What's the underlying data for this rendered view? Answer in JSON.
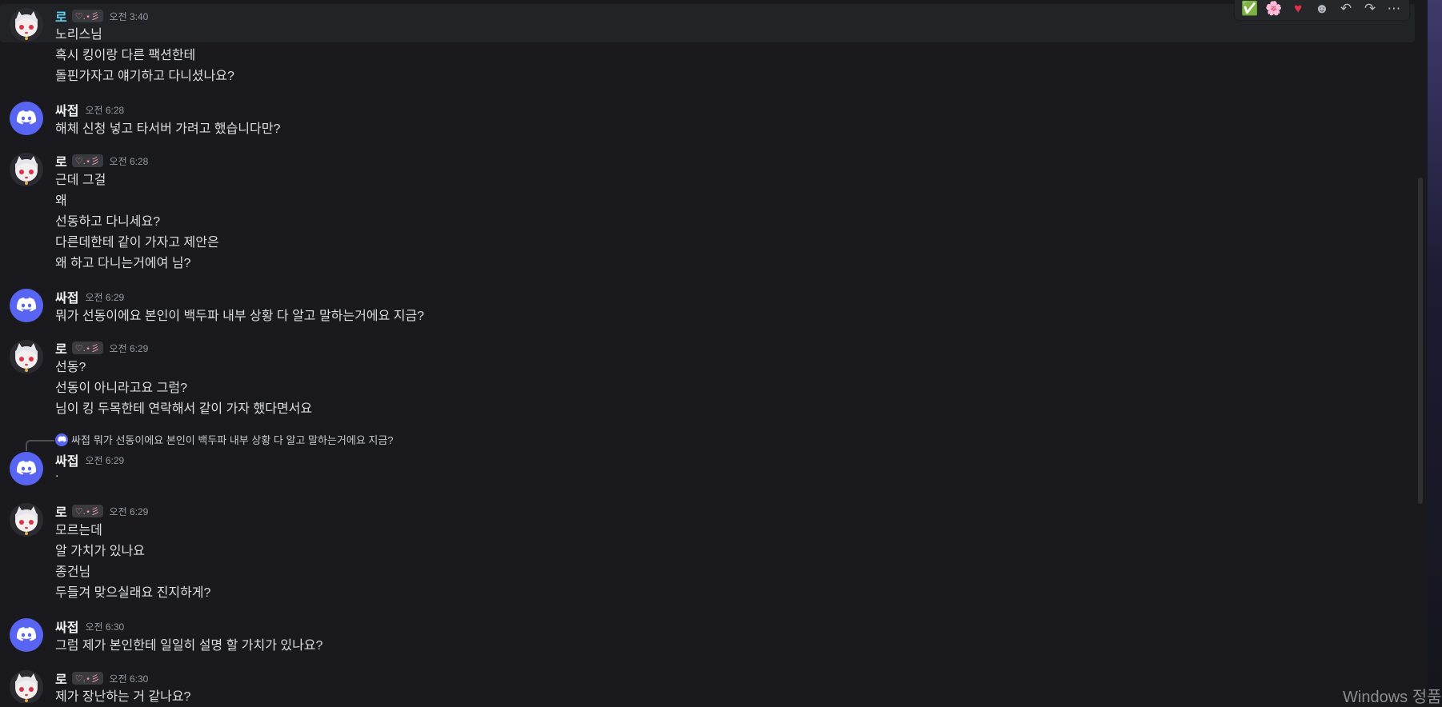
{
  "toolbar": {
    "icons": [
      "check-reaction",
      "cherry-blossom-reaction",
      "heart-reaction",
      "add-reaction-icon",
      "reply-icon",
      "forward-icon",
      "more-icon"
    ],
    "check": "✅",
    "flower": "🌸",
    "heart": "♥",
    "smile": "☻",
    "reply": "↶",
    "forward": "↷",
    "more": "⋯"
  },
  "users": {
    "ro": {
      "name": "로",
      "tag": "♡.⋆彡"
    },
    "ssajeop": {
      "name": "싸접"
    }
  },
  "messages": [
    {
      "author": "로",
      "time": "오전 3:40",
      "lines": [
        "노리스님",
        "혹시 킹이랑 다른 팩션한테",
        "돌핀가자고 얘기하고 다니셨나요?"
      ]
    },
    {
      "author": "싸접",
      "time": "오전 6:28",
      "lines": [
        "해체 신청 넣고 타서버 가려고 했습니다만?"
      ]
    },
    {
      "author": "로",
      "time": "오전 6:28",
      "lines": [
        "근데 그걸",
        "왜",
        "선동하고 다니세요?",
        "다른데한테 같이 가자고 제안은",
        "왜 하고 다니는거에여 님?"
      ]
    },
    {
      "author": "싸접",
      "time": "오전 6:29",
      "lines": [
        "뭐가 선동이에요 본인이 백두파 내부 상황 다 알고 말하는거에요 지금?"
      ]
    },
    {
      "author": "로",
      "time": "오전 6:29",
      "lines": [
        "선동?",
        "선동이 아니라고요 그럼?",
        "님이 킹 두목한테 연락해서 같이 가자 했다면서요"
      ]
    },
    {
      "author": "싸접",
      "time": "오전 6:29",
      "reply_name": "싸접",
      "reply_text": "뭐가 선동이에요 본인이 백두파 내부 상황 다 알고 말하는거에요 지금?",
      "lines": [
        "."
      ]
    },
    {
      "author": "로",
      "time": "오전 6:29",
      "lines": [
        "모르는데",
        "알 가치가 있나요",
        "종건님",
        "두들겨 맞으실래요 진지하게?"
      ]
    },
    {
      "author": "싸접",
      "time": "오전 6:30",
      "lines": [
        "그럼 제가 본인한테 일일히 설명 할 가치가 있나요?"
      ]
    },
    {
      "author": "로",
      "time": "오전 6:30",
      "lines": [
        "제가 장난하는 거 같나요?"
      ]
    }
  ],
  "watermark": "Windows 정품",
  "colors": {
    "blurple": "#5865f2",
    "background": "#1a1a1e",
    "text": "#dbdee1",
    "timestamp": "#949ba4"
  }
}
